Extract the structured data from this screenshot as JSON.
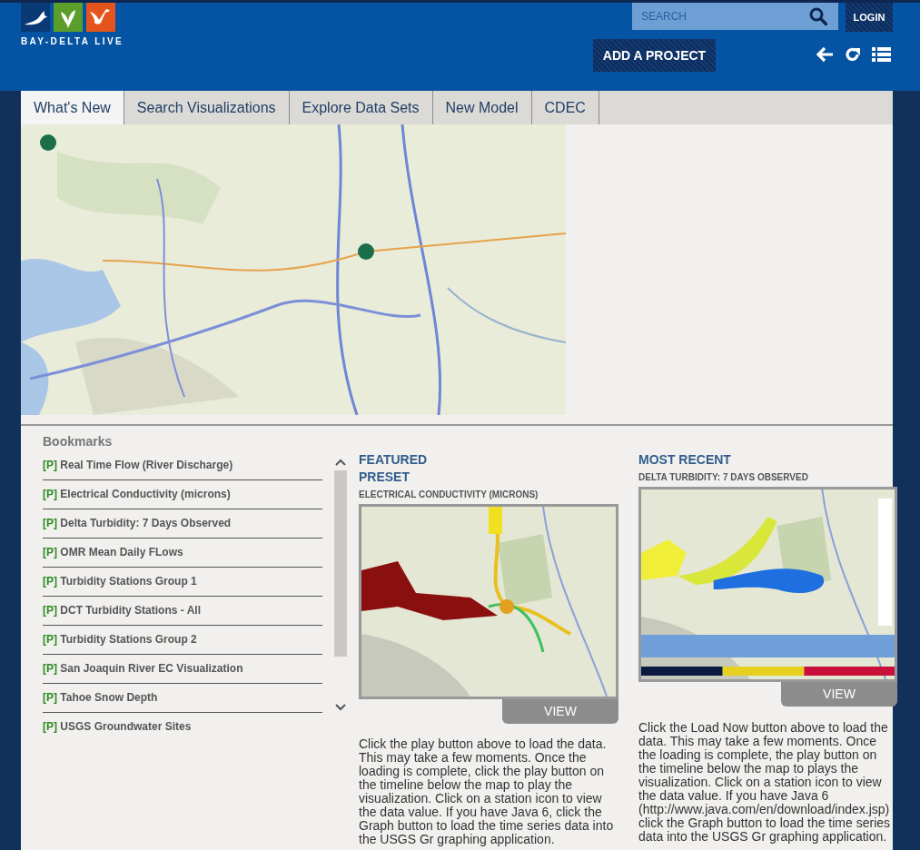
{
  "header": {
    "logo_text": "BAY-DELTA LIVE",
    "search": {
      "placeholder": "SEARCH"
    },
    "login": "LOGIN",
    "add_project": "ADD A PROJECT"
  },
  "tabs": [
    {
      "label": "What's New",
      "selected": true
    },
    {
      "label": "Search Visualizations",
      "selected": false
    },
    {
      "label": "Explore Data Sets",
      "selected": false
    },
    {
      "label": "New Model",
      "selected": false
    },
    {
      "label": "CDEC",
      "selected": false
    }
  ],
  "bookmarks": {
    "title": "Bookmarks",
    "items": [
      {
        "tag": "[P]",
        "title": "Real Time Flow (River Discharge)"
      },
      {
        "tag": "[P]",
        "title": "Electrical Conductivity (microns)"
      },
      {
        "tag": "[P]",
        "title": "Delta Turbidity: 7 Days Observed"
      },
      {
        "tag": "[P]",
        "title": "OMR Mean Daily FLows"
      },
      {
        "tag": "[P]",
        "title": "Turbidity Stations Group 1"
      },
      {
        "tag": "[P]",
        "title": "DCT Turbidity Stations - All"
      },
      {
        "tag": "[P]",
        "title": "Turbidity Stations Group 2"
      },
      {
        "tag": "[P]",
        "title": "San Joaquin River EC Visualization"
      },
      {
        "tag": "[P]",
        "title": "Tahoe Snow Depth"
      },
      {
        "tag": "[P]",
        "title": "USGS Groundwater Sites"
      }
    ]
  },
  "panels": [
    {
      "heading": "FEATURED PRESET",
      "subtitle": "ELECTRICAL CONDUCTIVITY (MICRONS)",
      "view": "VIEW",
      "description": "Click the play button above to load the data. This may take a few moments. Once the loading is complete, click the play button on the timeline below the map to play the visualization. Click on a station icon to view the data value. If you have Java 6, click the Graph button to load the time series data into the USGS Gr graphing application."
    },
    {
      "heading": "MOST RECENT",
      "subtitle": "DELTA TURBIDITY: 7 DAYS OBSERVED",
      "view": "VIEW",
      "description": "Click the Load Now button above to load the data. This may take a few moments. Once the loading is complete, the play button on the timeline below the map to plays the visualization. Click on a station icon to view the data value. If you have Java 6 (http://www.java.com/en/download/index.jsp) click the Graph button to load the time series data into the USGS Gr graphing application."
    }
  ]
}
